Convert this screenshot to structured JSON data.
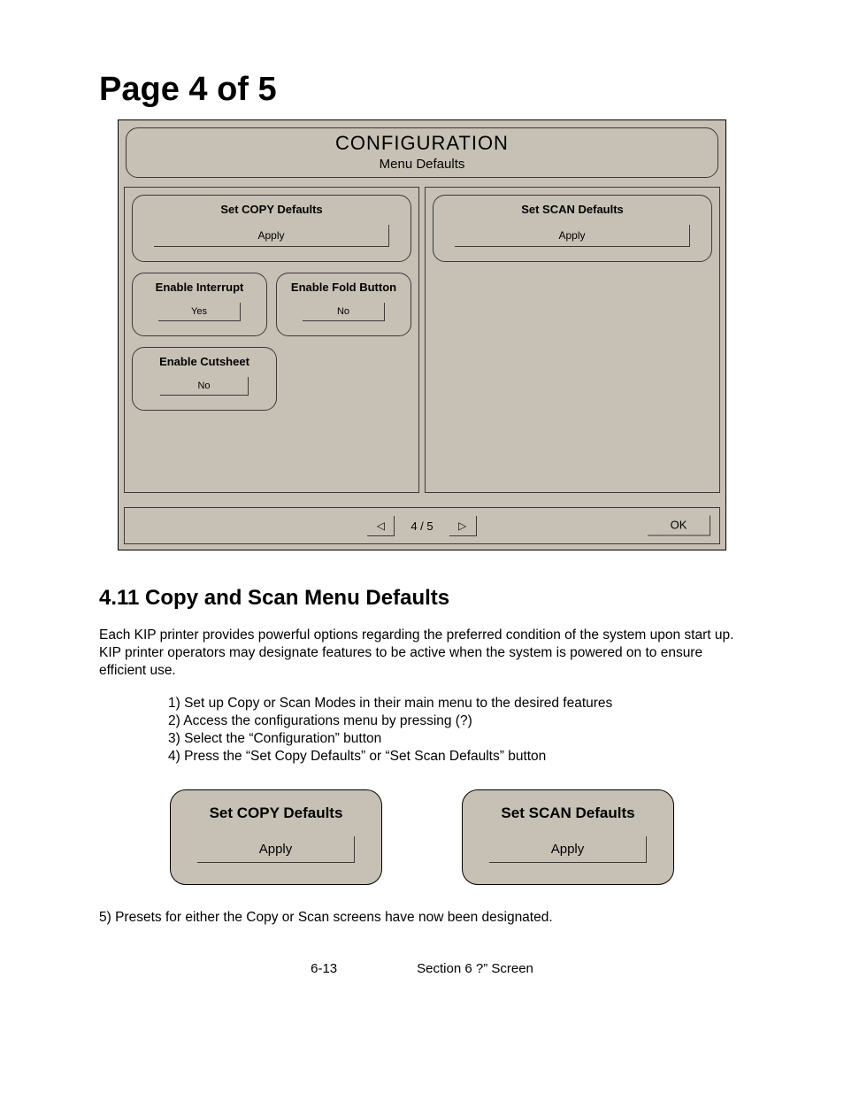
{
  "page_heading": "Page 4 of 5",
  "config": {
    "title": "CONFIGURATION",
    "subtitle": "Menu Defaults",
    "left": {
      "set_copy": {
        "label": "Set COPY Defaults",
        "button": "Apply"
      },
      "enable_interrupt": {
        "label": "Enable Interrupt",
        "value": "Yes"
      },
      "enable_fold": {
        "label": "Enable Fold Button",
        "value": "No"
      },
      "enable_cutsheet": {
        "label": "Enable Cutsheet",
        "value": "No"
      }
    },
    "right": {
      "set_scan": {
        "label": "Set SCAN Defaults",
        "button": "Apply"
      }
    },
    "nav": {
      "prev_glyph": "◁",
      "indicator": "4 / 5",
      "next_glyph": "▷",
      "ok": "OK"
    }
  },
  "section": {
    "heading": "4.11 Copy and Scan Menu Defaults",
    "intro": "Each KIP printer provides powerful options regarding the preferred condition of the system upon start up.  KIP printer operators may designate features to be active when the system is powered on to ensure efficient use.",
    "steps": [
      "1)  Set up Copy or Scan Modes in their main menu to the desired features",
      "2)  Access the configurations menu by pressing (?)",
      "3)  Select the “Configuration” button",
      "4)  Press the “Set Copy Defaults” or “Set Scan Defaults” button"
    ],
    "big_copy": {
      "label": "Set COPY Defaults",
      "button": "Apply"
    },
    "big_scan": {
      "label": "Set SCAN Defaults",
      "button": "Apply"
    },
    "step5": "5)  Presets for either the Copy or Scan screens have now been designated."
  },
  "footer": {
    "page_num": "6-13",
    "section_label": "Section 6     ?” Screen"
  }
}
